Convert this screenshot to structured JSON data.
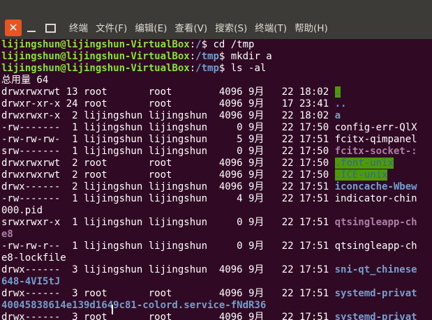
{
  "menubar": {
    "close_glyph": "✕",
    "items": [
      "终端",
      "文件(F)",
      "编辑(E)",
      "查看(V)",
      "搜索(S)",
      "终端(T)",
      "帮助(H)"
    ]
  },
  "terminal": {
    "colors": {
      "background": "#300a24",
      "prompt_user": "#8ae234",
      "prompt_path": "#729fcf",
      "directory": "#729fcf",
      "socket": "#ad7fa8",
      "sticky_bg": "#4e9a06"
    },
    "commands": [
      {
        "user": "lijingshun@lijingshun-VirtualBox",
        "path": "/",
        "cmd": "cd /tmp"
      },
      {
        "user": "lijingshun@lijingshun-VirtualBox",
        "path": "/tmp",
        "cmd": "mkdir a"
      },
      {
        "user": "lijingshun@lijingshun-VirtualBox",
        "path": "/tmp",
        "cmd": "ls -al"
      }
    ],
    "total": "总用量 64",
    "entries": [
      {
        "info": "drwxrwxrwt 13 root       root        4096 9月   22 18:02 ",
        "name": ".",
        "kind": "sticky"
      },
      {
        "info": "drwxr-xr-x 24 root       root        4096 9月   17 23:41 ",
        "name": "..",
        "kind": "dir"
      },
      {
        "info": "drwxrwxr-x  2 lijingshun lijingshun  4096 9月   22 18:02 ",
        "name": "a",
        "kind": "dir"
      },
      {
        "info": "-rw-------  1 lijingshun lijingshun     0 9月   22 17:50 ",
        "name": "config-err-QlX",
        "kind": "file"
      },
      {
        "info": "-rw-rw-rw-  1 lijingshun lijingshun     5 9月   22 17:51 ",
        "name": "fcitx-qimpanel",
        "kind": "file"
      },
      {
        "info": "srw-------  1 lijingshun lijingshun     0 9月   22 17:50 ",
        "name": "fcitx-socket-:",
        "kind": "socket"
      },
      {
        "info": "drwxrwxrwt  2 root       root        4096 9月   22 17:50 ",
        "name": ".font-unix",
        "kind": "sticky"
      },
      {
        "info": "drwxrwxrwt  2 root       root        4096 9月   22 17:50 ",
        "name": ".ICE-unix",
        "kind": "sticky"
      },
      {
        "info": "drwx------  2 lijingshun lijingshun  4096 9月   22 17:51 ",
        "name": "iconcache-Wbew",
        "kind": "dir"
      },
      {
        "info": "-rw-------  1 lijingshun lijingshun     4 9月   22 17:51 ",
        "name": "indicator-chin",
        "kind": "file"
      },
      {
        "info": "000.pid",
        "name": "",
        "kind": "wrap"
      },
      {
        "info": "srwxrwxr-x  1 lijingshun lijingshun     0 9月   22 17:51 ",
        "name": "qtsingleapp-ch",
        "kind": "socket"
      },
      {
        "info": "",
        "name": "e8",
        "kind": "socket"
      },
      {
        "info": "-rw-rw-r--  1 lijingshun lijingshun     0 9月   22 17:51 ",
        "name": "qtsingleapp-ch",
        "kind": "file"
      },
      {
        "info": "e8-lockfile",
        "name": "",
        "kind": "wrap"
      },
      {
        "info": "drwx------  3 lijingshun lijingshun  4096 9月   22 17:51 ",
        "name": "sni-qt_chinese",
        "kind": "dir"
      },
      {
        "info": "",
        "name": "648-4VI5tJ",
        "kind": "dir"
      },
      {
        "info": "drwx------  3 root       root        4096 9月   22 17:51 ",
        "name": "systemd-privat",
        "kind": "dir"
      },
      {
        "info": "",
        "name": "40045838614e139d1649c81-colord.service-fNdR36",
        "kind": "dir"
      },
      {
        "info": "drwx------  3 root       root        4096 9月   22 17:51 ",
        "name": "systemd-privat",
        "kind": "dir"
      }
    ]
  }
}
